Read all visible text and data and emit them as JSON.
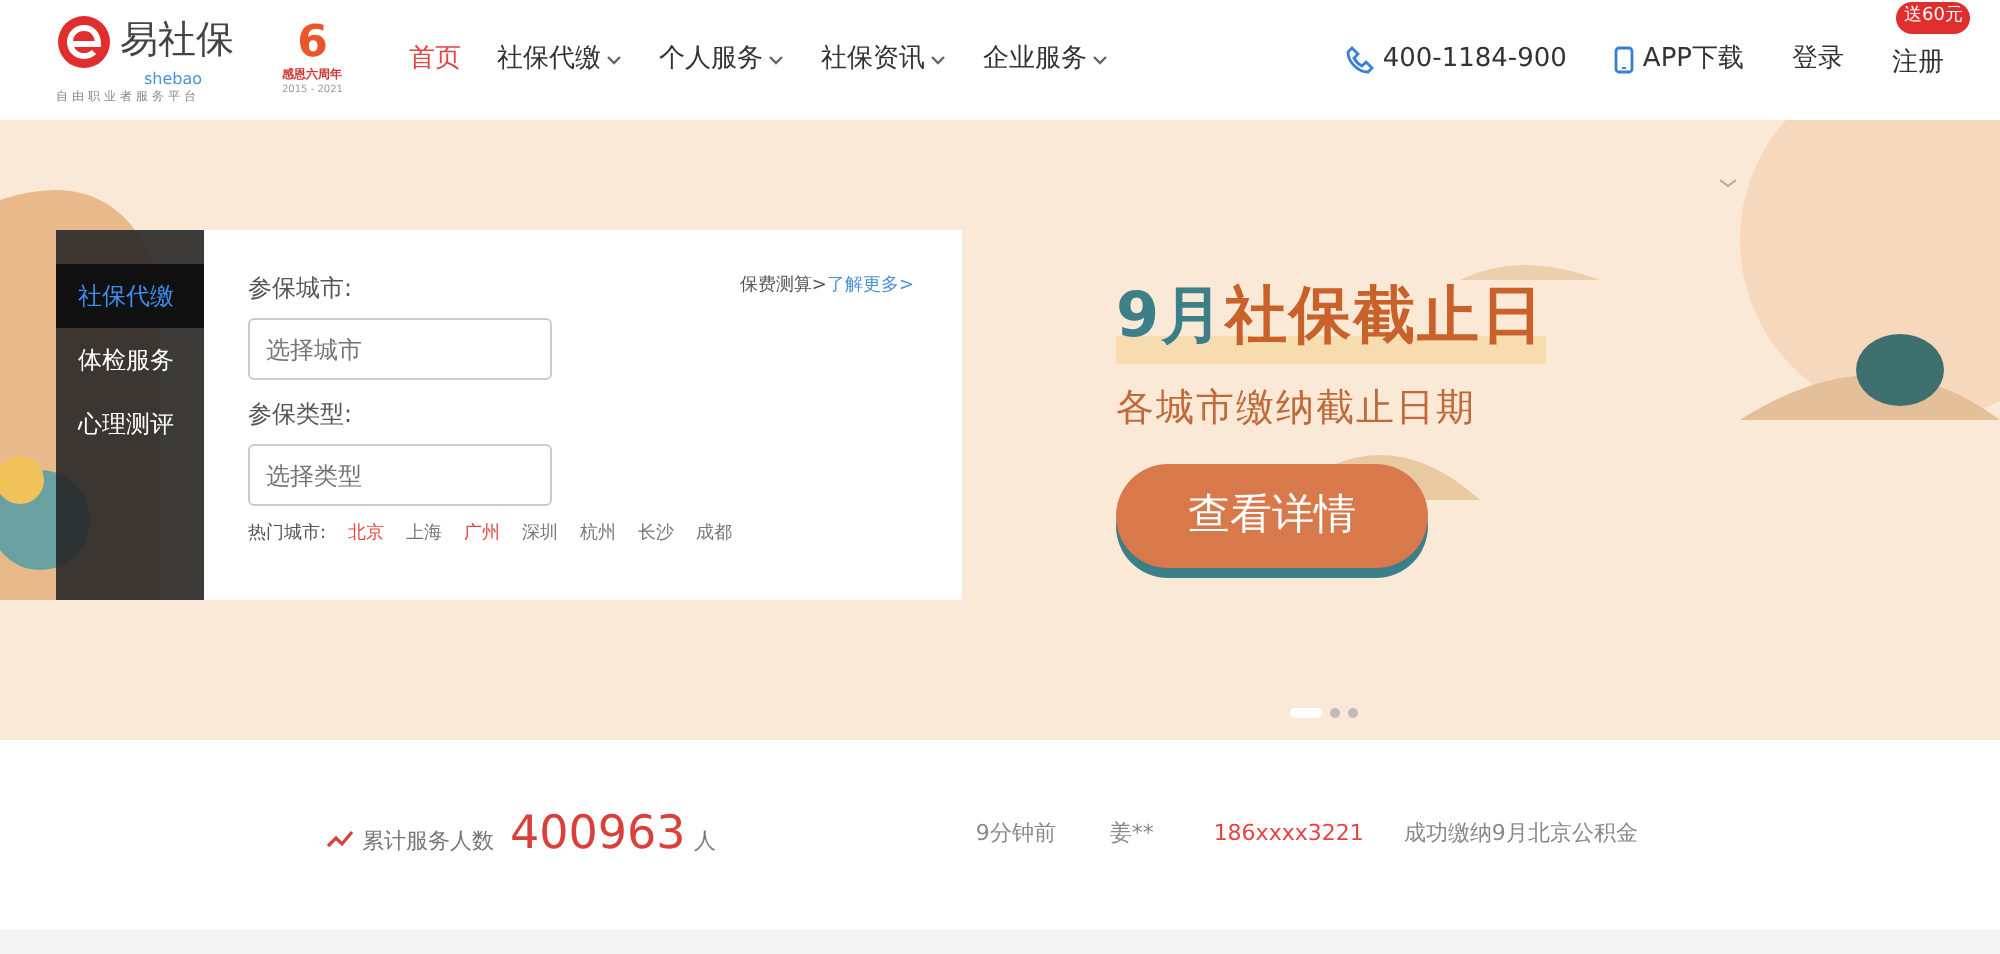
{
  "header": {
    "logo": {
      "name": "易社保",
      "sub": "shebao",
      "slogan": "自由职业者服务平台"
    },
    "anniversary": {
      "number": "6",
      "label": "感恩六周年",
      "years": "2015 - 2021"
    },
    "nav": [
      {
        "label": "首页",
        "selected": true,
        "dropdown": false
      },
      {
        "label": "社保代缴",
        "selected": false,
        "dropdown": true
      },
      {
        "label": "个人服务",
        "selected": false,
        "dropdown": true
      },
      {
        "label": "社保资讯",
        "selected": false,
        "dropdown": true
      },
      {
        "label": "企业服务",
        "selected": false,
        "dropdown": true
      }
    ],
    "phone": "400-1184-900",
    "app": "APP下载",
    "login": "登录",
    "register": "注册",
    "register_badge": "送60元"
  },
  "hero": {
    "side_tabs": [
      {
        "label": "社保代缴",
        "selected": true
      },
      {
        "label": "体检服务",
        "selected": false
      },
      {
        "label": "心理测评",
        "selected": false
      }
    ],
    "form": {
      "calc_link": "保费测算>",
      "more_link": "了解更多>",
      "fields": [
        {
          "label": "参保城市:",
          "placeholder": "选择城市"
        },
        {
          "label": "参保类型:",
          "placeholder": "选择类型"
        }
      ],
      "hot_label": "热门城市:",
      "hot_cities": [
        {
          "name": "北京",
          "highlight": true
        },
        {
          "name": "上海",
          "highlight": false
        },
        {
          "name": "广州",
          "highlight": true
        },
        {
          "name": "深圳",
          "highlight": false
        },
        {
          "name": "杭州",
          "highlight": false
        },
        {
          "name": "长沙",
          "highlight": false
        },
        {
          "name": "成都",
          "highlight": false
        }
      ]
    },
    "banner": {
      "title_highlight": "9月",
      "title": "社保截止日",
      "subtitle": "各城市缴纳截止日期",
      "button": "查看详情"
    },
    "dots": [
      {
        "selected": true
      },
      {
        "selected": false
      },
      {
        "selected": false
      }
    ]
  },
  "stats": {
    "label": "累计服务人数",
    "count": "400963",
    "unit": "人",
    "records": [
      {
        "time": "9分钟前",
        "name": "姜**",
        "phone": "186xxxx3221",
        "action": "成功缴纳9月北京公积金"
      }
    ]
  }
}
